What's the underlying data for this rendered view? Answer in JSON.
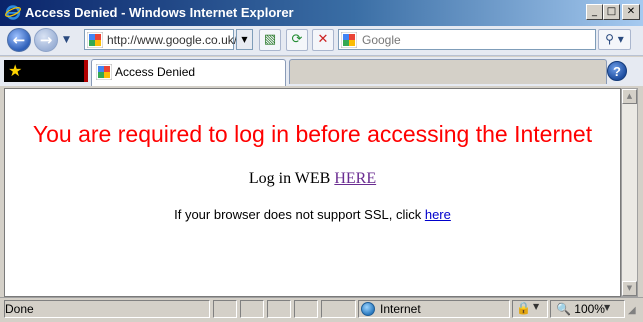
{
  "window": {
    "title": "Access Denied - Windows Internet Explorer"
  },
  "caption_buttons": {
    "minimize": "_",
    "maximize": "□",
    "close": "✕"
  },
  "toolbar": {
    "back_icon": "back-arrow-icon",
    "forward_icon": "forward-arrow-icon",
    "address_value": "http://www.google.co.uk/",
    "address_favicon": "google-favicon",
    "compat_icon": "compatibility-view-icon",
    "refresh_icon": "refresh-icon",
    "stop_icon": "stop-icon",
    "search_placeholder": "Google",
    "search_icon": "search-magnifier-icon"
  },
  "tabs": {
    "favorites_icon": "favorites-star-icon",
    "active_tab_label": "Access Denied",
    "help_label": "?"
  },
  "page": {
    "heading": "You are required to log in before accessing the Internet",
    "login_prefix": "Log in WEB ",
    "login_link": "HERE",
    "ssl_prefix": "If your browser does not support SSL, click ",
    "ssl_link": "here"
  },
  "statusbar": {
    "status": "Done",
    "zone": "Internet",
    "zoom": "100%"
  },
  "colors": {
    "heading": "#ff0000",
    "visited_link": "#6a2c91",
    "link": "#0000cc",
    "titlebar_start": "#0a246a",
    "titlebar_end": "#a6caf0"
  }
}
